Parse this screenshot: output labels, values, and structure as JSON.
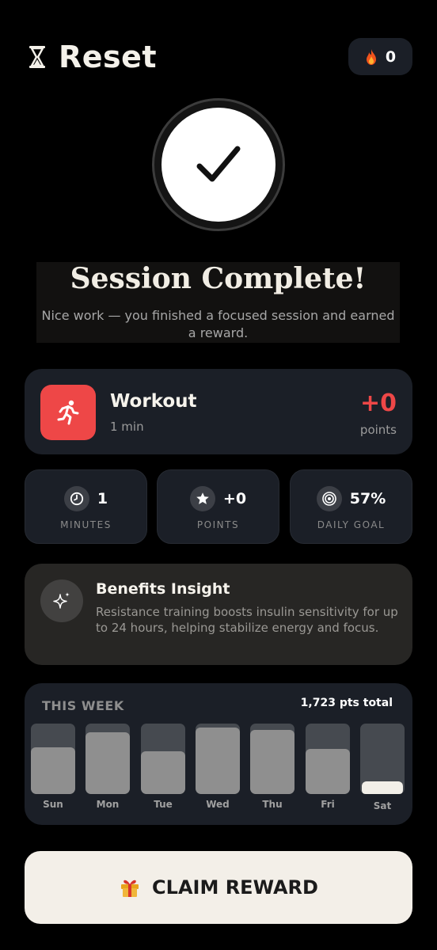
{
  "header": {
    "app_title": "Reset",
    "hourglass_icon": "hourglass-icon",
    "streak_icon": "fire-icon",
    "streak_count": "0"
  },
  "completion": {
    "icon": "checkmark-icon",
    "title": "Session Complete!",
    "subtitle": "Nice work — you finished a focused session and earned a reward."
  },
  "workout": {
    "icon": "running-person-icon",
    "name": "Workout",
    "duration": "1 min",
    "points": "+0",
    "points_label": "points",
    "accent_color": "#EE4747"
  },
  "stats": [
    {
      "icon": "clock-icon",
      "value": "1",
      "label": "MINUTES"
    },
    {
      "icon": "star-icon",
      "value": "+0",
      "label": "POINTS"
    },
    {
      "icon": "target-icon",
      "value": "57%",
      "label": "DAILY GOAL"
    }
  ],
  "insight": {
    "icon": "sparkle-icon",
    "title": "Benefits Insight",
    "text": "Resistance training boosts insulin sensitivity for up to 24 hours, helping stabilize energy and focus."
  },
  "week": {
    "title": "THIS WEEK",
    "total": "1,723 pts total",
    "days": [
      {
        "label": "Sun",
        "level": 0.66
      },
      {
        "label": "Mon",
        "level": 0.88
      },
      {
        "label": "Tue",
        "level": 0.61
      },
      {
        "label": "Wed",
        "level": 0.94
      },
      {
        "label": "Thu",
        "level": 0.91
      },
      {
        "label": "Fri",
        "level": 0.64
      },
      {
        "label": "Sat",
        "level": 0.19,
        "today": true
      }
    ]
  },
  "cta": {
    "icon": "gift-icon",
    "label": "CLAIM REWARD"
  }
}
